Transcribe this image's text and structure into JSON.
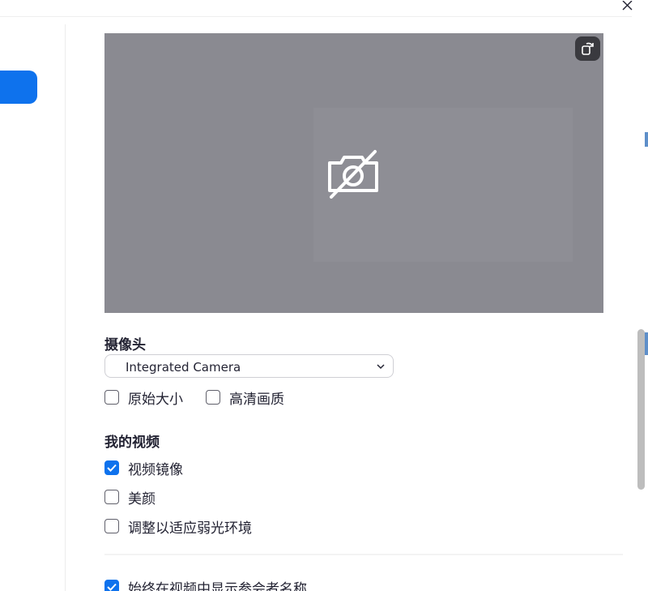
{
  "camera": {
    "section_title": "摄像头",
    "selected_device": "Integrated Camera",
    "options": [
      {
        "label": "原始大小",
        "checked": false
      },
      {
        "label": "高清画质",
        "checked": false
      }
    ]
  },
  "my_video": {
    "section_title": "我的视频",
    "options": [
      {
        "label": "视频镜像",
        "checked": true
      },
      {
        "label": "美颜",
        "checked": false
      },
      {
        "label": "调整以适应弱光环境",
        "checked": false
      }
    ]
  },
  "extra_option": {
    "label": "始终在视频中显示参会者名称",
    "checked": true
  },
  "icons": {
    "close": "close-icon",
    "rotate": "rotate-icon",
    "camera_off": "camera-off-icon",
    "dropdown": "chevron-down-icon",
    "check": "check-icon"
  },
  "colors": {
    "accent": "#0e72ed",
    "preview_bg": "#8a8a91"
  }
}
